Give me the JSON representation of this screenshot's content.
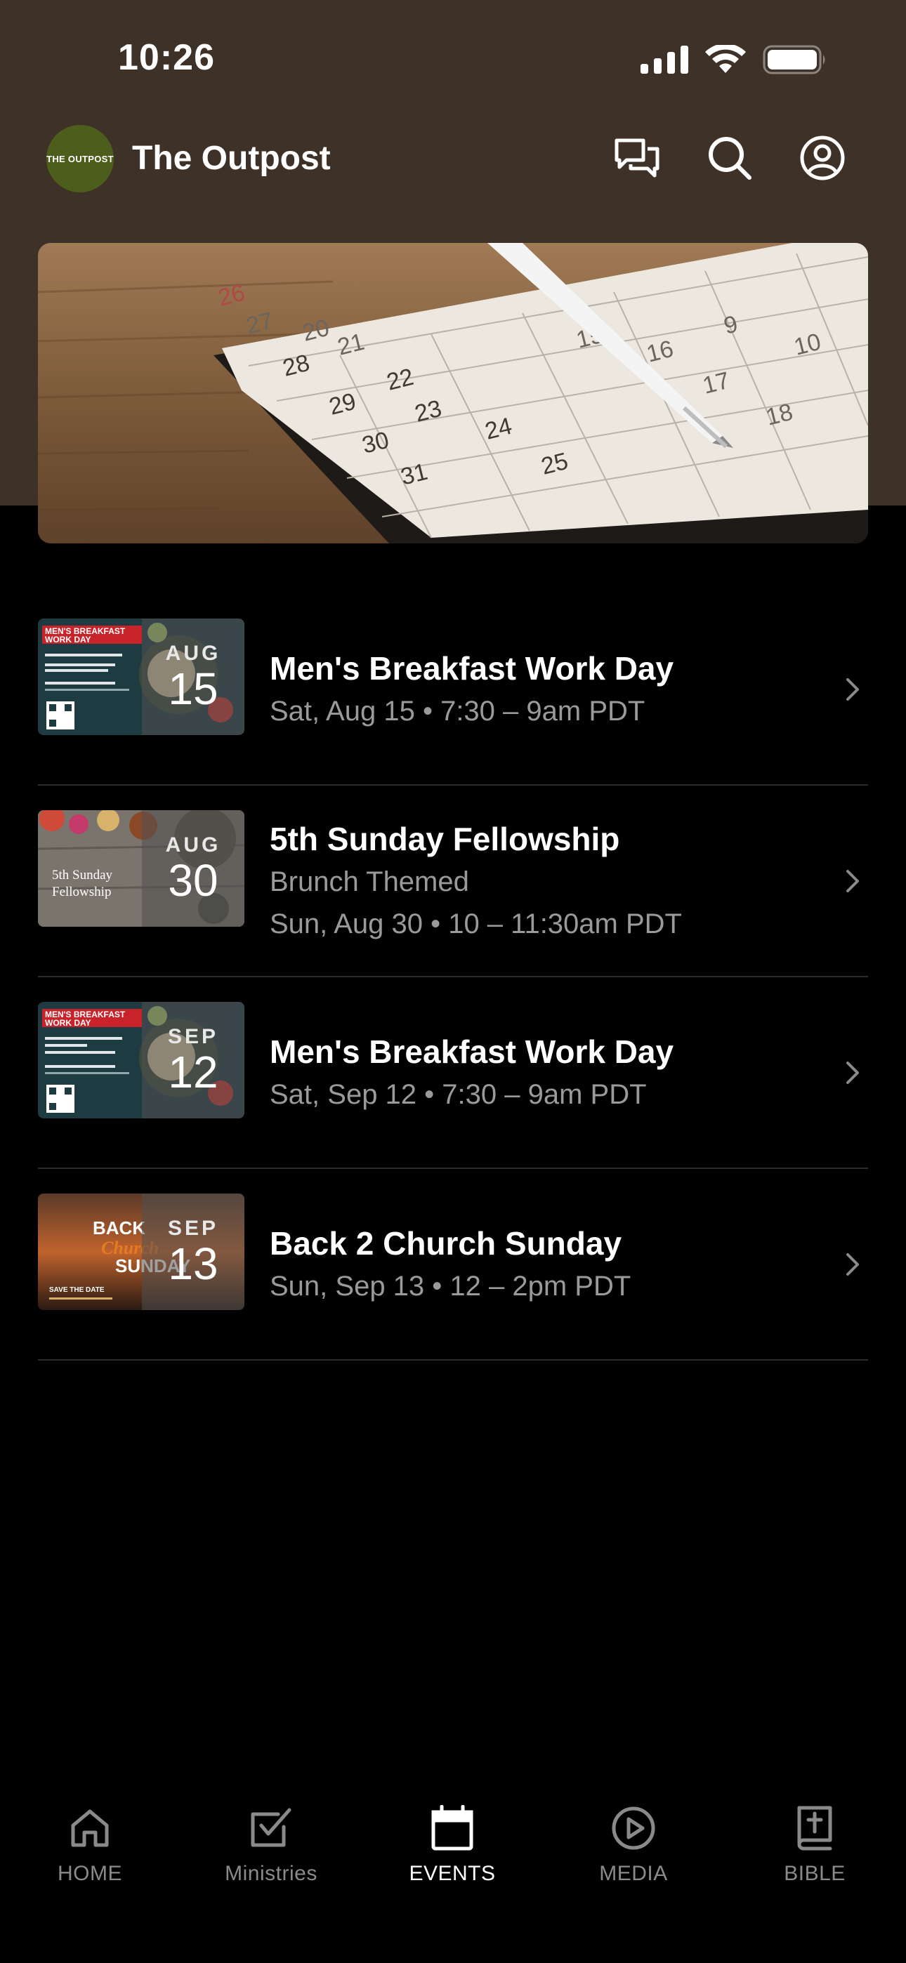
{
  "status": {
    "time": "10:26"
  },
  "header": {
    "logo_text": "THE OUTPOST",
    "title": "The Outpost",
    "icons": [
      "chat-icon",
      "search-icon",
      "profile-icon"
    ]
  },
  "hero": {
    "description_icon": "calendar-photo"
  },
  "events": [
    {
      "title": "Men's Breakfast Work Day",
      "subtitle": "",
      "when": "Sat, Aug 15 • 7:30 – 9am PDT",
      "month": "AUG",
      "day": "15",
      "thumb_theme": "breakfast"
    },
    {
      "title": "5th Sunday Fellowship",
      "subtitle": "Brunch Themed",
      "when": "Sun, Aug 30 • 10 – 11:30am PDT",
      "month": "AUG",
      "day": "30",
      "thumb_theme": "fellowship"
    },
    {
      "title": "Men's Breakfast Work Day",
      "subtitle": "",
      "when": "Sat, Sep 12 • 7:30 – 9am PDT",
      "month": "SEP",
      "day": "12",
      "thumb_theme": "breakfast"
    },
    {
      "title": "Back 2 Church Sunday",
      "subtitle": "",
      "when": "Sun, Sep 13 • 12 – 2pm PDT",
      "month": "SEP",
      "day": "13",
      "thumb_theme": "back2church"
    }
  ],
  "thumbs": {
    "breakfast_line1": "MEN'S BREAKFAST",
    "breakfast_line2": "WORK DAY",
    "fellowship_line1": "5th Sunday",
    "fellowship_line2": "Fellowship",
    "b2c_back": "BACK",
    "b2c_church": "Church",
    "b2c_sunday": "SUNDAY",
    "b2c_save": "SAVE THE DATE"
  },
  "tabs": [
    {
      "label": "HOME",
      "icon": "home-icon",
      "active": false
    },
    {
      "label": "Ministries",
      "icon": "checkbox-icon",
      "active": false
    },
    {
      "label": "EVENTS",
      "icon": "calendar-icon",
      "active": true
    },
    {
      "label": "MEDIA",
      "icon": "play-icon",
      "active": false
    },
    {
      "label": "BIBLE",
      "icon": "bible-icon",
      "active": false
    }
  ],
  "colors": {
    "header_bg": "#3e3128",
    "background": "#000000",
    "secondary_text": "#9a9a9a",
    "logo_green": "#4d5d1c"
  }
}
